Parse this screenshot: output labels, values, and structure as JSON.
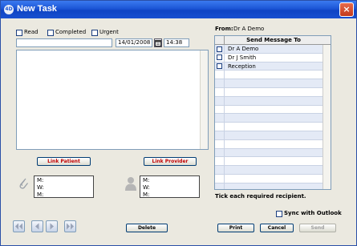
{
  "window": {
    "title": "New Task",
    "app_icon": "4D"
  },
  "status": {
    "read_label": "Read",
    "completed_label": "Completed",
    "urgent_label": "Urgent"
  },
  "task": {
    "subject": "",
    "date": "14/01/2008",
    "time": "14:38",
    "body": ""
  },
  "links": {
    "patient_label": "Link Patient",
    "provider_label": "Link Provider"
  },
  "contact": {
    "m_label": "M:",
    "w_label": "W:"
  },
  "from": {
    "label": "From:",
    "value": "Dr A Demo"
  },
  "recipients": {
    "header": "Send Message To",
    "items": [
      {
        "name": "Dr A Demo"
      },
      {
        "name": "Dr J Smith"
      },
      {
        "name": "Reception"
      }
    ],
    "hint": "Tick each required recipient."
  },
  "sync_label": "Sync with Outlook",
  "buttons": {
    "delete": "Delete",
    "print": "Print",
    "cancel": "Cancel",
    "send": "Send"
  },
  "close_glyph": "×",
  "icons": [
    "first-record-icon",
    "previous-record-icon",
    "next-record-icon",
    "last-record-icon",
    "calendar-icon",
    "paperclip-icon",
    "person-icon",
    "close-icon"
  ]
}
